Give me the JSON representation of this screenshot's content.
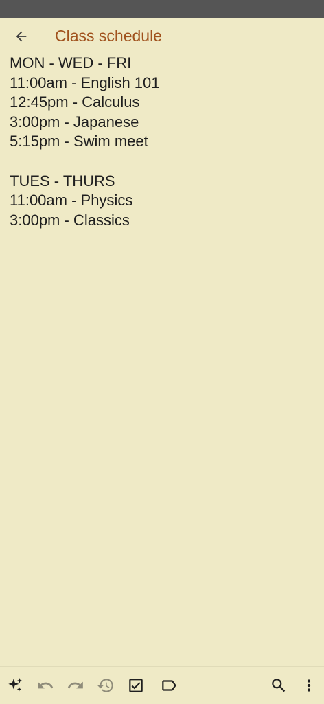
{
  "header": {
    "title": "Class schedule"
  },
  "note": {
    "lines": [
      "MON - WED - FRI",
      "11:00am - English 101",
      "12:45pm - Calculus",
      "3:00pm - Japanese",
      "5:15pm - Swim meet",
      "",
      "TUES - THURS",
      "11:00am - Physics",
      "3:00pm - Classics"
    ]
  },
  "icons": {
    "back": "arrow-back-icon",
    "ai": "sparkle-icon",
    "undo": "undo-icon",
    "redo": "redo-icon",
    "history": "history-icon",
    "checklist": "checkbox-icon",
    "label": "label-icon",
    "search": "search-icon",
    "more": "more-vert-icon"
  },
  "colors": {
    "background": "#efeac6",
    "title": "#a0521d",
    "text": "#1f1f1f",
    "icon_active": "#1f1f1f",
    "icon_disabled": "#8f8c7a",
    "status_bar": "#555555"
  }
}
